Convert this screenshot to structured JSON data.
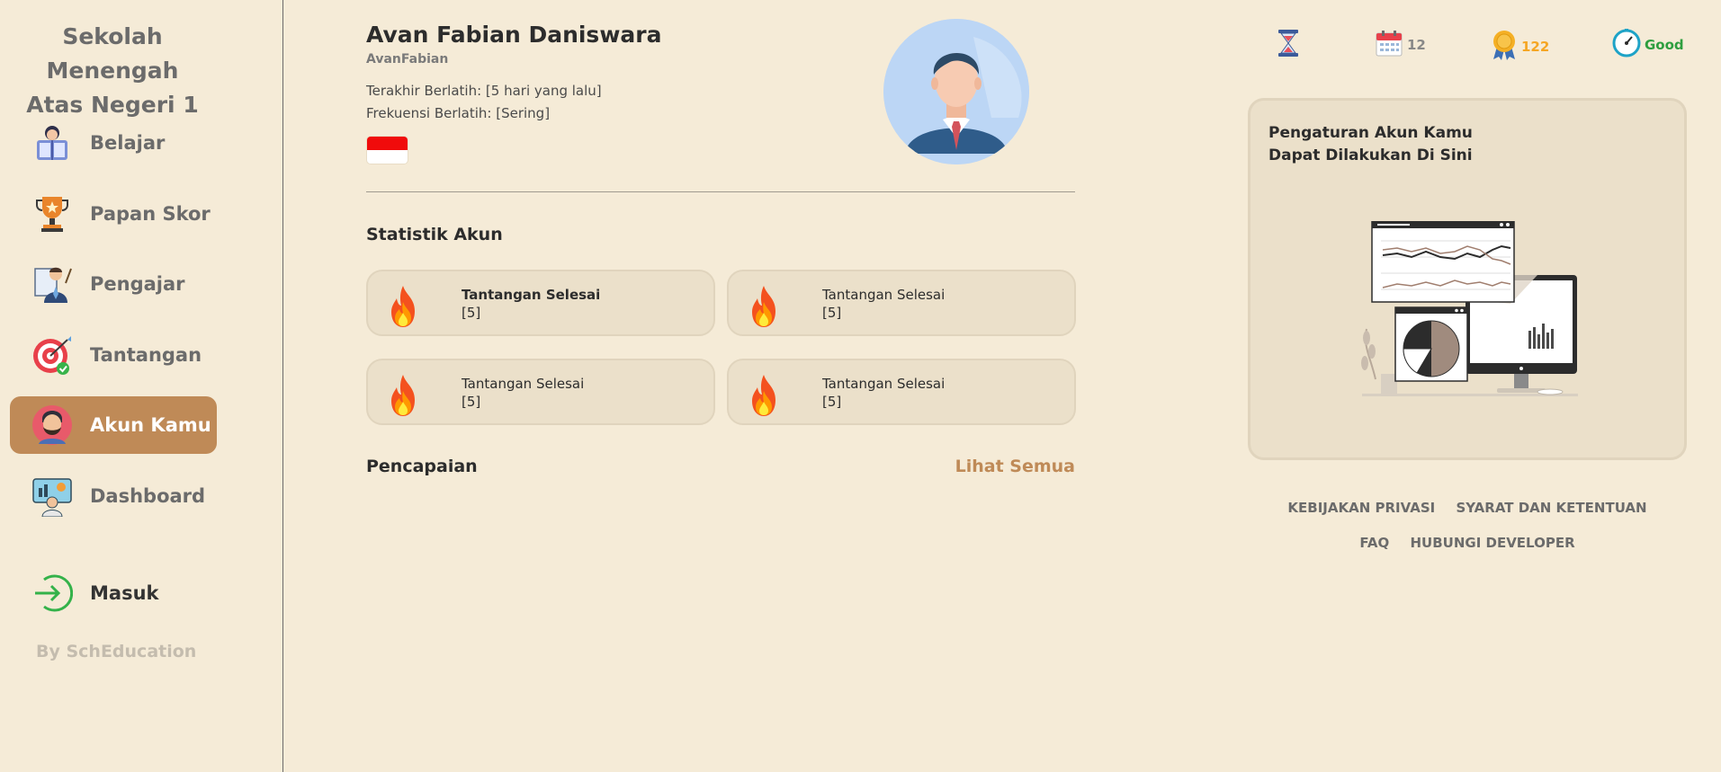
{
  "sidebar": {
    "school_name_line1": "Sekolah Menengah",
    "school_name_line2": "Atas Negeri 1",
    "items": [
      {
        "label": "Belajar",
        "icon": "reading-student-icon"
      },
      {
        "label": "Papan Skor",
        "icon": "trophy-icon"
      },
      {
        "label": "Pengajar",
        "icon": "teacher-icon"
      },
      {
        "label": "Tantangan",
        "icon": "target-icon"
      },
      {
        "label": "Akun Kamu",
        "icon": "user-avatar-icon",
        "active": true
      },
      {
        "label": "Dashboard",
        "icon": "dashboard-person-icon"
      }
    ],
    "login": {
      "label": "Masuk",
      "icon": "login-arrow-icon"
    },
    "byline": "By SchEducation"
  },
  "profile": {
    "name": "Avan Fabian Daniswara",
    "username": "AvanFabian",
    "last_trained": "Terakhir Berlatih: [5 hari yang lalu]",
    "frequency": "Frekuensi Berlatih: [Sering]",
    "flag": "indonesia-flag-icon",
    "avatar": "businessman-avatar-icon"
  },
  "stats": {
    "title": "Statistik Akun",
    "cards": [
      {
        "label": "Tantangan Selesai",
        "value": "[5]"
      },
      {
        "label": "Tantangan Selesai",
        "value": "[5]"
      },
      {
        "label": "Tantangan Selesai",
        "value": "[5]"
      },
      {
        "label": "Tantangan Selesai",
        "value": "[5]"
      }
    ]
  },
  "achievements": {
    "title": "Pencapaian",
    "see_all": "Lihat Semua"
  },
  "topbar": {
    "hourglass_icon": "hourglass-icon",
    "calendar_value": "12",
    "medal_value": "122",
    "status_value": "Good",
    "colors": {
      "calendar": "#888888",
      "medal": "#f5a623",
      "status": "#2e9e3f"
    }
  },
  "settings_card": {
    "line1": "Pengaturan Akun Kamu",
    "line2": "Dapat Dilakukan Di Sini",
    "illustration": "analytics-monitor-illustration"
  },
  "footer": {
    "privacy": "KEBIJAKAN PRIVASI",
    "terms": "SYARAT DAN KETENTUAN",
    "faq": "FAQ",
    "contact": "HUBUNGI DEVELOPER"
  },
  "colors": {
    "background": "#f5ebd7",
    "accent": "#bf8a57",
    "card": "#ebe0ca"
  }
}
